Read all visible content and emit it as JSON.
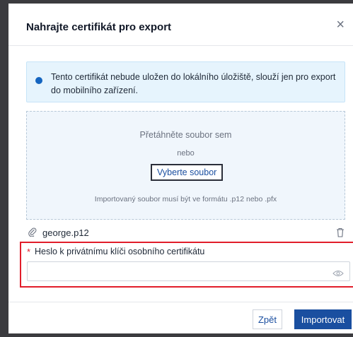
{
  "dialog": {
    "title": "Nahrajte certifikát pro export",
    "close_glyph": "×"
  },
  "info": {
    "text": "Tento certifikát nebude uložen do lokálního úložiště, slouží jen pro export do mobilního zařízení.",
    "icon": "info-dot-icon",
    "color": "#1565c0"
  },
  "upload": {
    "drag_text": "Přetáhněte soubor sem",
    "or_text": "nebo",
    "select_button": "Vyberte soubor",
    "hint": "Importovaný soubor musí být ve formátu .p12 nebo .pfx"
  },
  "file": {
    "name": "george.p12",
    "clip_glyph": "🖇",
    "icons": [
      "paperclip-icon",
      "trash-icon"
    ]
  },
  "password": {
    "required_mark": "*",
    "label": "Heslo k privátnímu klíči osobního certifikátu",
    "value": "",
    "placeholder": "",
    "icon": "eye-icon",
    "highlight_color": "#e11d2a"
  },
  "footer": {
    "back_label": "Zpět",
    "import_label": "Importovat",
    "primary_color": "#1a4fa0"
  }
}
